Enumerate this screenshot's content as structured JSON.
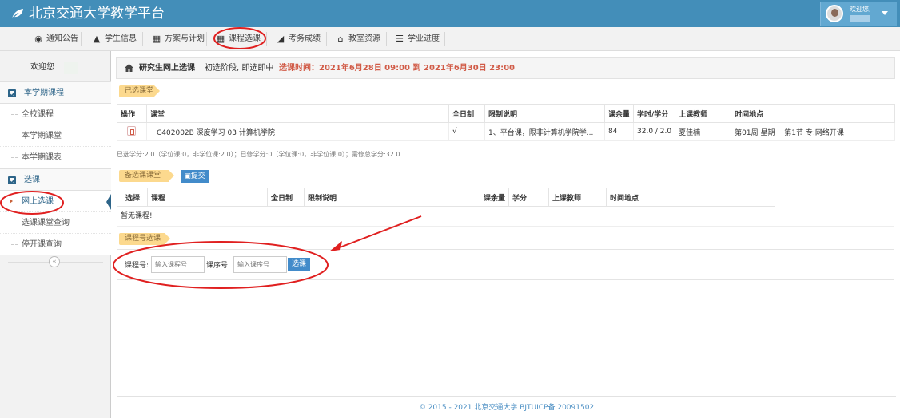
{
  "app": {
    "title": "北京交通大学教学平台"
  },
  "user": {
    "greeting": "欢迎您,"
  },
  "nav": {
    "items": [
      {
        "label": "通知公告",
        "icon": "globe-icon"
      },
      {
        "label": "学生信息",
        "icon": "graduation-cap-icon"
      },
      {
        "label": "方案与计划",
        "icon": "calendar-icon"
      },
      {
        "label": "课程选课",
        "icon": "calendar-icon"
      },
      {
        "label": "考务成绩",
        "icon": "area-chart-icon"
      },
      {
        "label": "教室资源",
        "icon": "bank-icon"
      },
      {
        "label": "学业进度",
        "icon": "list-icon"
      }
    ]
  },
  "sidebar": {
    "welcome": "欢迎您",
    "groups": [
      {
        "label": "本学期课程",
        "items": [
          "全校课程",
          "本学期课堂",
          "本学期课表"
        ]
      },
      {
        "label": "选课",
        "items": [
          "网上选课",
          "选课课堂查询",
          "停开课查询"
        ]
      }
    ],
    "active_item": "网上选课"
  },
  "breadcrumb": {
    "title": "研究生网上选课",
    "stage": "初选阶段, 即选即中",
    "time": "选课时间：2021年6月28日 09:00 到 2021年6月30日 23:00"
  },
  "selected": {
    "ribbon": "已选课堂",
    "headers": [
      "操作",
      "课堂",
      "全日制",
      "限制说明",
      "课余量",
      "学时/学分",
      "上课教师",
      "时间地点"
    ],
    "rows": [
      {
        "course": "C402002B 深度学习 03 计算机学院",
        "fulltime": "√",
        "limit": "1、平台课，限非计算机学院学...",
        "remain": "84",
        "hours": "32.0 / 2.0",
        "teacher": "夏佳楠",
        "time": "第01周 星期一 第1节 专:网络开课"
      }
    ],
    "summary": "已选学分:2.0（学位课:0，非学位课:2.0）；已修学分:0（学位课:0，非学位课:0）；需修总学分:32.0"
  },
  "candidate": {
    "ribbon": "备选课课堂",
    "submit": "提交",
    "headers": [
      "选择",
      "课程",
      "全日制",
      "限制说明",
      "课余量",
      "学分",
      "上课教师",
      "时间地点"
    ],
    "empty": "暂无课程!"
  },
  "search": {
    "ribbon": "课程号选课",
    "course_label": "课程号:",
    "course_placeholder": "输入课程号",
    "section_label": "课序号:",
    "section_placeholder": "输入课序号",
    "button": "选课"
  },
  "footer": {
    "text": "© 2015 - 2021 北京交通大学 BJTUICP备 20091502"
  },
  "colors": {
    "header": "#438eb9",
    "accent": "#2e6589",
    "danger": "#d15b47",
    "ribbon": "#fcd98e",
    "annotation": "#e02020"
  }
}
